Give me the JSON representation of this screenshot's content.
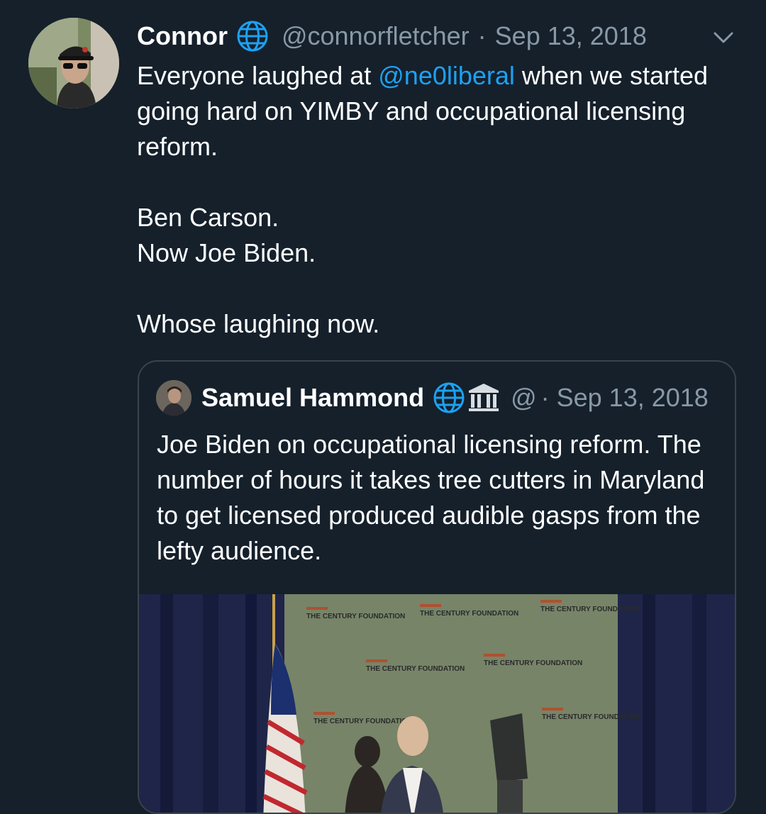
{
  "tweet": {
    "author_name": "Connor",
    "handle": "@connorfletcher",
    "separator": "·",
    "date": "Sep 13, 2018",
    "avatar_icon": "profile-photo-man-in-car",
    "verified_icon": "globe-icon",
    "menu_icon": "chevron-down-icon",
    "text": {
      "line1_prefix": "Everyone laughed at ",
      "mention": "@ne0liberal",
      "line1_suffix": " when we started going hard on YIMBY and occupational licensing reform.",
      "line2": "Ben Carson.",
      "line3": "Now Joe Biden.",
      "line4": "Whose laughing now."
    }
  },
  "quoted_tweet": {
    "author_name": "Samuel Hammond",
    "icons": [
      "globe-icon",
      "classical-building-icon"
    ],
    "handle": "@",
    "separator": "·",
    "date": "Sep 13, 2018",
    "text": "Joe Biden on occupational licensing reform. The number of hours it takes tree cutters in Maryland to get licensed produced audible gasps from the lefty audience.",
    "media": {
      "type": "video-still",
      "backdrop_text": "THE CENTURY FOUNDATION"
    }
  },
  "colors": {
    "background": "#15202b",
    "text": "#ffffff",
    "secondary": "#8899a6",
    "link": "#1da1f2",
    "border": "#38444d"
  }
}
